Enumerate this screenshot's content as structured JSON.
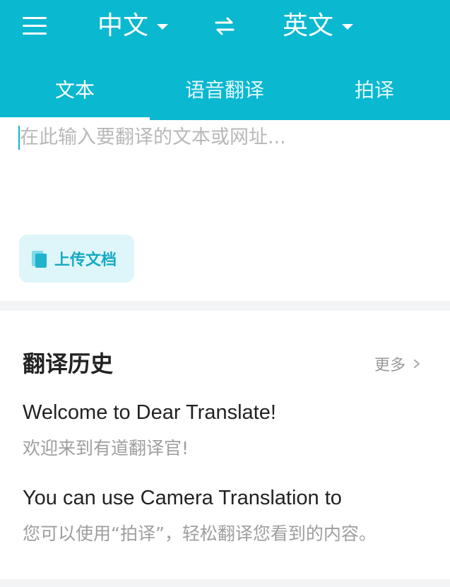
{
  "header": {
    "source_lang": "中文",
    "target_lang": "英文",
    "tabs": [
      {
        "label": "文本",
        "active": true
      },
      {
        "label": "语音翻译",
        "active": false
      },
      {
        "label": "拍译",
        "active": false
      }
    ],
    "accent_color": "#0ab8d0"
  },
  "input": {
    "value": "",
    "placeholder": "在此输入要翻译的文本或网址..."
  },
  "upload": {
    "label": "上传文档"
  },
  "history": {
    "title": "翻译历史",
    "more_label": "更多",
    "entries": [
      {
        "source": "Welcome to Dear Translate!",
        "translation": "欢迎来到有道翻译官!"
      },
      {
        "source": "You can use Camera Translation to",
        "translation": "您可以使用“拍译”，轻松翻译您看到的内容。"
      }
    ]
  }
}
